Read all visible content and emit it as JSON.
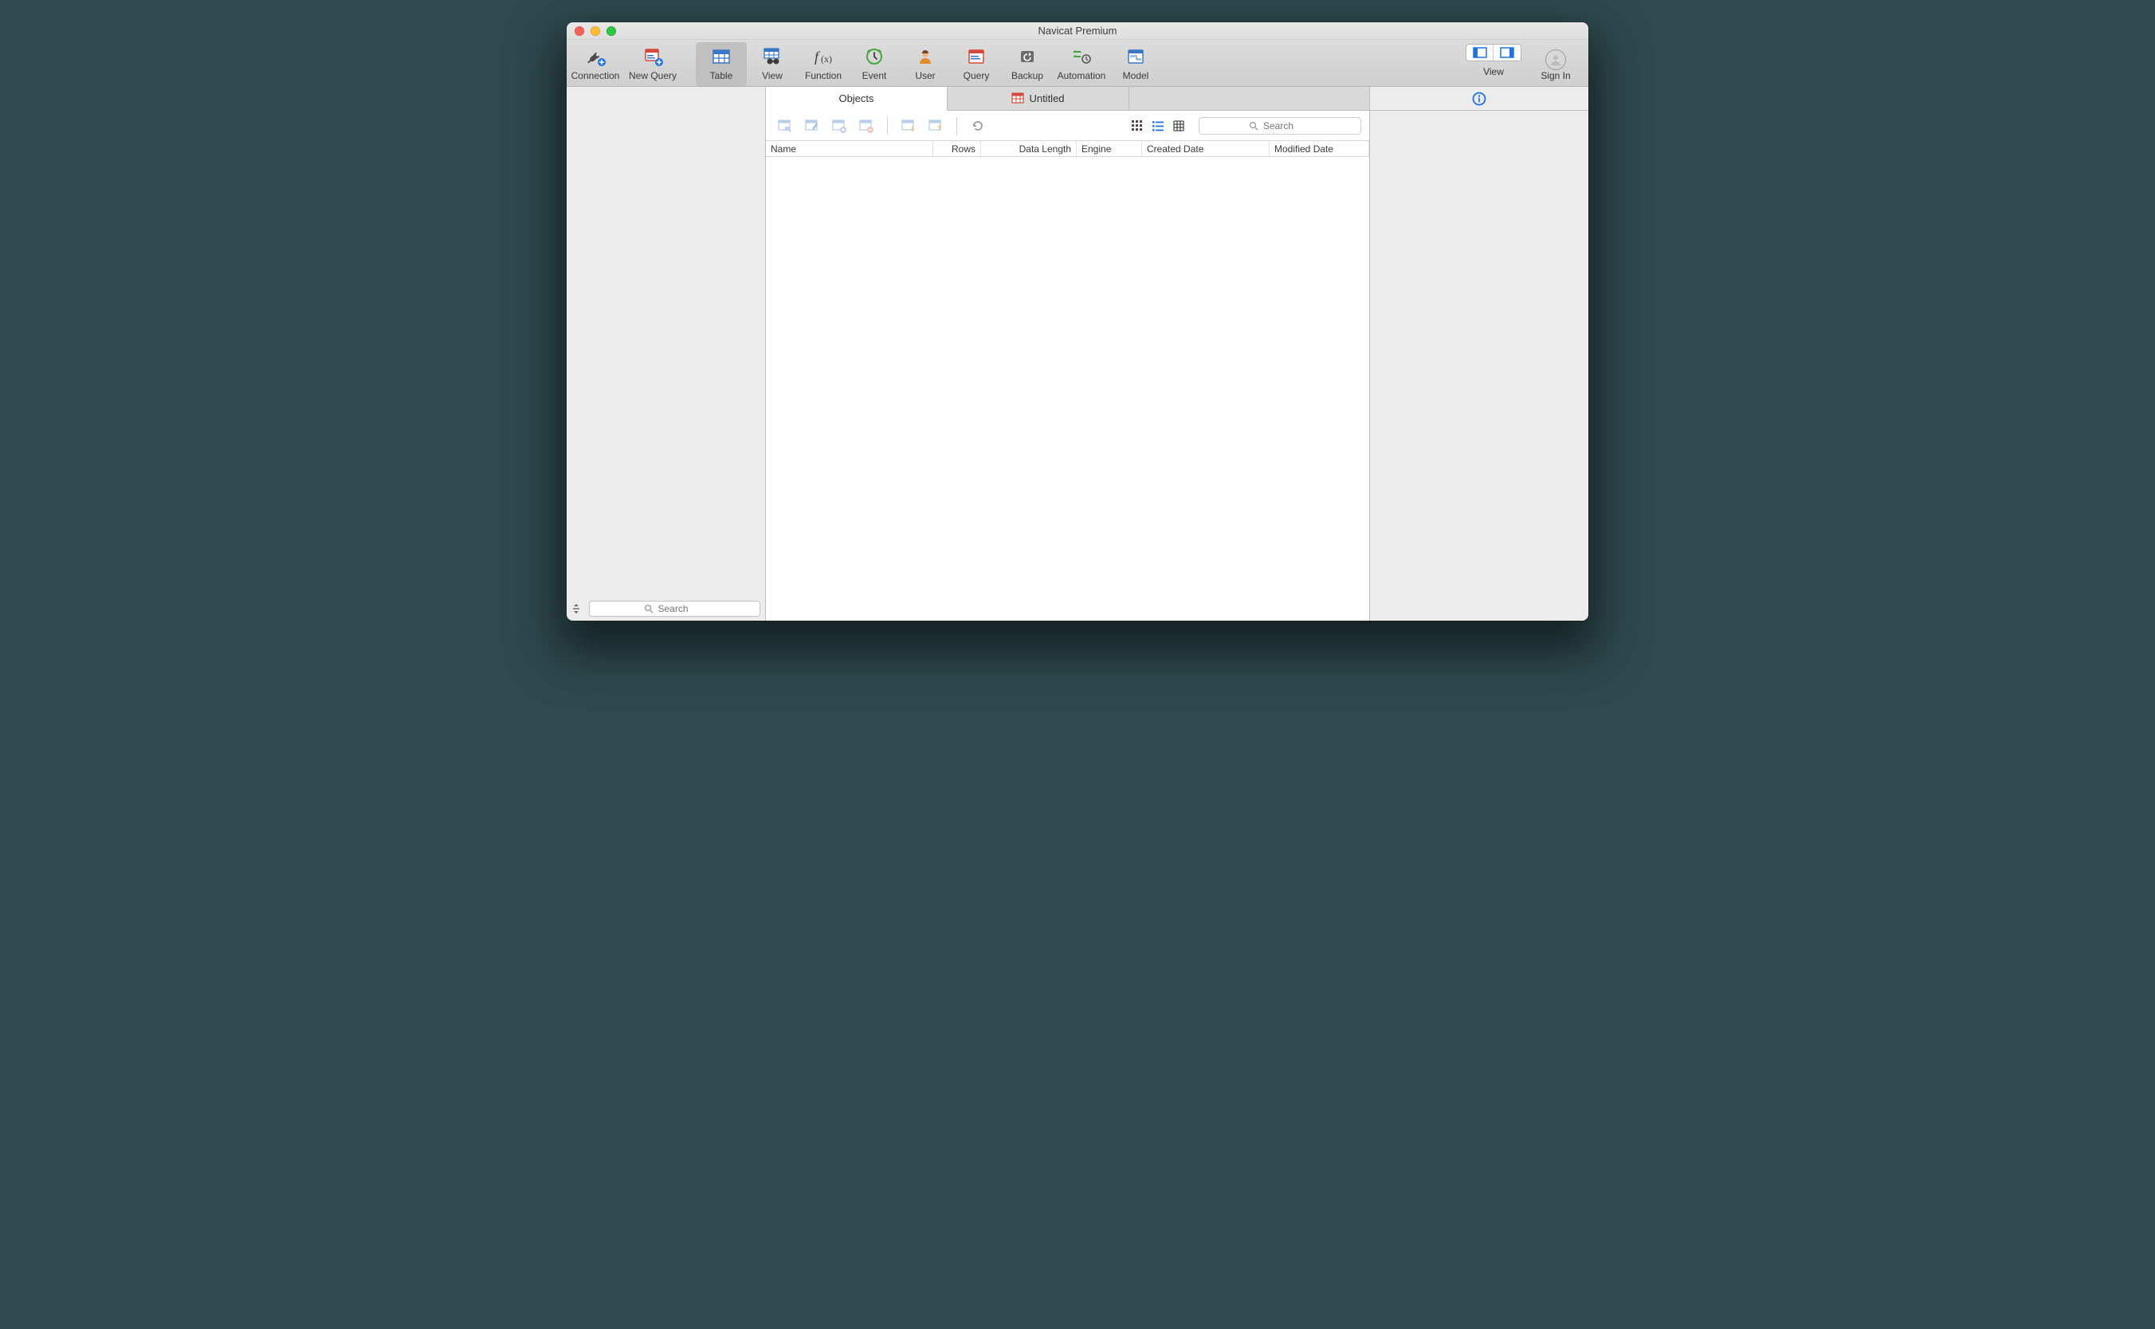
{
  "window": {
    "title": "Navicat Premium"
  },
  "toolbar": {
    "connection": "Connection",
    "newQuery": "New Query",
    "table": "Table",
    "view": "View",
    "function": "Function",
    "event": "Event",
    "user": "User",
    "query": "Query",
    "backup": "Backup",
    "automation": "Automation",
    "model": "Model",
    "viewToggle": "View",
    "signIn": "Sign In"
  },
  "tabs": {
    "objects": "Objects",
    "untitled": "Untitled"
  },
  "objbar": {
    "searchPlaceholder": "Search"
  },
  "columns": {
    "name": "Name",
    "rows": "Rows",
    "dataLength": "Data Length",
    "engine": "Engine",
    "createdDate": "Created Date",
    "modifiedDate": "Modified Date"
  },
  "sidebar": {
    "searchPlaceholder": "Search"
  }
}
